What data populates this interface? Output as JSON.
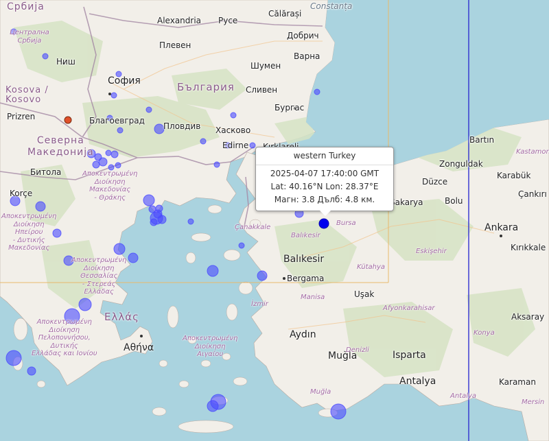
{
  "colors": {
    "sea": "#aad3df",
    "land": "#f2efe9",
    "terrain": "#d6e3c4",
    "border": "#a58aa5",
    "quake": "#4a4aff",
    "quake_selected": "#0000ee",
    "quake_red": "#e0502a",
    "tile_line": "#e8b86a",
    "date_line": "#3030d0"
  },
  "cities": [
    {
      "id": "calarasi",
      "name": "Călărași"
    },
    {
      "id": "constanta",
      "name": "Constanța"
    },
    {
      "id": "alexandria",
      "name": "Alexandria"
    },
    {
      "id": "ruse",
      "name": "Русе"
    },
    {
      "id": "dobrich",
      "name": "Добрич"
    },
    {
      "id": "pleven",
      "name": "Плевен"
    },
    {
      "id": "varna",
      "name": "Варна"
    },
    {
      "id": "shumen",
      "name": "Шумен"
    },
    {
      "id": "nis",
      "name": "Ниш"
    },
    {
      "id": "sofia",
      "name": "София"
    },
    {
      "id": "sliven",
      "name": "Сливен"
    },
    {
      "id": "burgas",
      "name": "Бургас"
    },
    {
      "id": "prizren",
      "name": "Prizren"
    },
    {
      "id": "blagoevgrad",
      "name": "Благоевград"
    },
    {
      "id": "plovdiv",
      "name": "Пловдив"
    },
    {
      "id": "haskovo",
      "name": "Хасково"
    },
    {
      "id": "edirne",
      "name": "Edirne"
    },
    {
      "id": "kirklareli",
      "name": "Kırklareli"
    },
    {
      "id": "bitola",
      "name": "Битола"
    },
    {
      "id": "korce",
      "name": "Korçe"
    },
    {
      "id": "bartin",
      "name": "Bartın"
    },
    {
      "id": "zonguldak",
      "name": "Zonguldak"
    },
    {
      "id": "karabuk",
      "name": "Karabük"
    },
    {
      "id": "duzce",
      "name": "Düzce"
    },
    {
      "id": "sakarya",
      "name": "Sakarya"
    },
    {
      "id": "bolu",
      "name": "Bolu"
    },
    {
      "id": "cankiri",
      "name": "Çankırı"
    },
    {
      "id": "ankara",
      "name": "Ankara"
    },
    {
      "id": "kirikkale",
      "name": "Kırıkkale"
    },
    {
      "id": "balikesir",
      "name": "Balıkesir"
    },
    {
      "id": "bergama",
      "name": "Bergama"
    },
    {
      "id": "usak",
      "name": "Uşak"
    },
    {
      "id": "aksaray",
      "name": "Aksaray"
    },
    {
      "id": "aydin",
      "name": "Aydın"
    },
    {
      "id": "isparta",
      "name": "Isparta"
    },
    {
      "id": "mugla",
      "name": "Muğla"
    },
    {
      "id": "antalya",
      "name": "Antalya"
    },
    {
      "id": "karaman",
      "name": "Karaman"
    },
    {
      "id": "athina",
      "name": "Αθήνα"
    }
  ],
  "countries": [
    {
      "id": "serbia",
      "name": "Србија"
    },
    {
      "id": "bulgaria",
      "name": "България"
    },
    {
      "id": "kosovo",
      "name": "Kosova /\nKosovo"
    },
    {
      "id": "north-macedonia",
      "name": "Северна\nМакедонија"
    },
    {
      "id": "greece",
      "name": "Ελλάς"
    }
  ],
  "regions": [
    {
      "id": "central-serbia",
      "name": "Централна\nСрбија"
    },
    {
      "id": "macedonia-thrace",
      "name": "Αποκεντρωμένη\nΔιοίκηση\nΜακεδονίας\n- Θράκης"
    },
    {
      "id": "epirus",
      "name": "Αποκεντρωμένη\nΔιοίκηση\nΗπείρου\n- Δυτικής\nΜακεδονίας"
    },
    {
      "id": "thessaly",
      "name": "Αποκεντρωμένη\nΔιοίκηση\nΘεσσαλίας\n- Στερεάς\nΕλλάδας"
    },
    {
      "id": "peloponnese",
      "name": "Αποκεντρωμένη\nΔιοίκηση\nΠελοποννήσου,\nΔυτικής\nΕλλάδας και Ιονίου"
    },
    {
      "id": "aegean",
      "name": "Αποκεντρωμένη\nΔιοίκηση\nΑιγαίου"
    },
    {
      "id": "canakkale",
      "name": "Çanakkale"
    },
    {
      "id": "balikesir-prov",
      "name": "Balıkesir"
    },
    {
      "id": "bursa",
      "name": "Bursa"
    },
    {
      "id": "eskisehir",
      "name": "Eskişehir"
    },
    {
      "id": "kutahya",
      "name": "Kütahya"
    },
    {
      "id": "izmir",
      "name": "İzmir"
    },
    {
      "id": "manisa",
      "name": "Manisa"
    },
    {
      "id": "afyonkarahisar",
      "name": "Afyonkarahisar"
    },
    {
      "id": "denizli",
      "name": "Denizli"
    },
    {
      "id": "mugla-prov",
      "name": "Muğla"
    },
    {
      "id": "konya",
      "name": "Konya"
    },
    {
      "id": "antalya-prov",
      "name": "Antalya"
    },
    {
      "id": "mersin",
      "name": "Mersin"
    },
    {
      "id": "kastamonu",
      "name": "Kastamonu"
    }
  ],
  "popup": {
    "title": "western Turkey",
    "datetime": "2025-04-07 17:40:00 GMT",
    "coords": "Lat: 40.16°N Lon: 28.37°E",
    "mag_depth": "Магн: 3.8 Дълб: 4.8 км."
  },
  "earthquakes_selected_icon": "selected-earthquake-marker"
}
